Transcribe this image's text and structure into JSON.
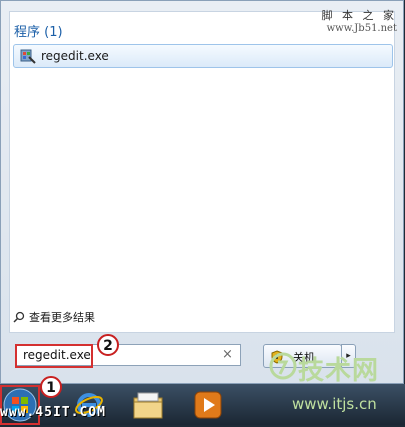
{
  "results": {
    "section_header": "程序 (1)",
    "items": [
      {
        "label": "regedit.exe",
        "icon": "regedit-icon"
      }
    ]
  },
  "see_more": {
    "label": "查看更多结果",
    "icon": "search-icon"
  },
  "search": {
    "value": "regedit.exe",
    "clear_glyph": "×"
  },
  "shutdown": {
    "label": "关机",
    "arrow": "▸"
  },
  "callouts": {
    "one": "1",
    "two": "2"
  },
  "watermarks": {
    "top_line1": "脚 本 之 家",
    "top_line2": "www.Jb51.net",
    "bottom_left": "www.45IT.COM",
    "logo_text": "技术网",
    "logo_url": "www.itjs.cn"
  },
  "taskbar": {
    "icons": [
      "windows-start-icon",
      "internet-explorer-icon",
      "explorer-folder-icon",
      "media-player-icon"
    ]
  },
  "colors": {
    "highlight": "#d43030",
    "accent": "#1b5fa8"
  }
}
